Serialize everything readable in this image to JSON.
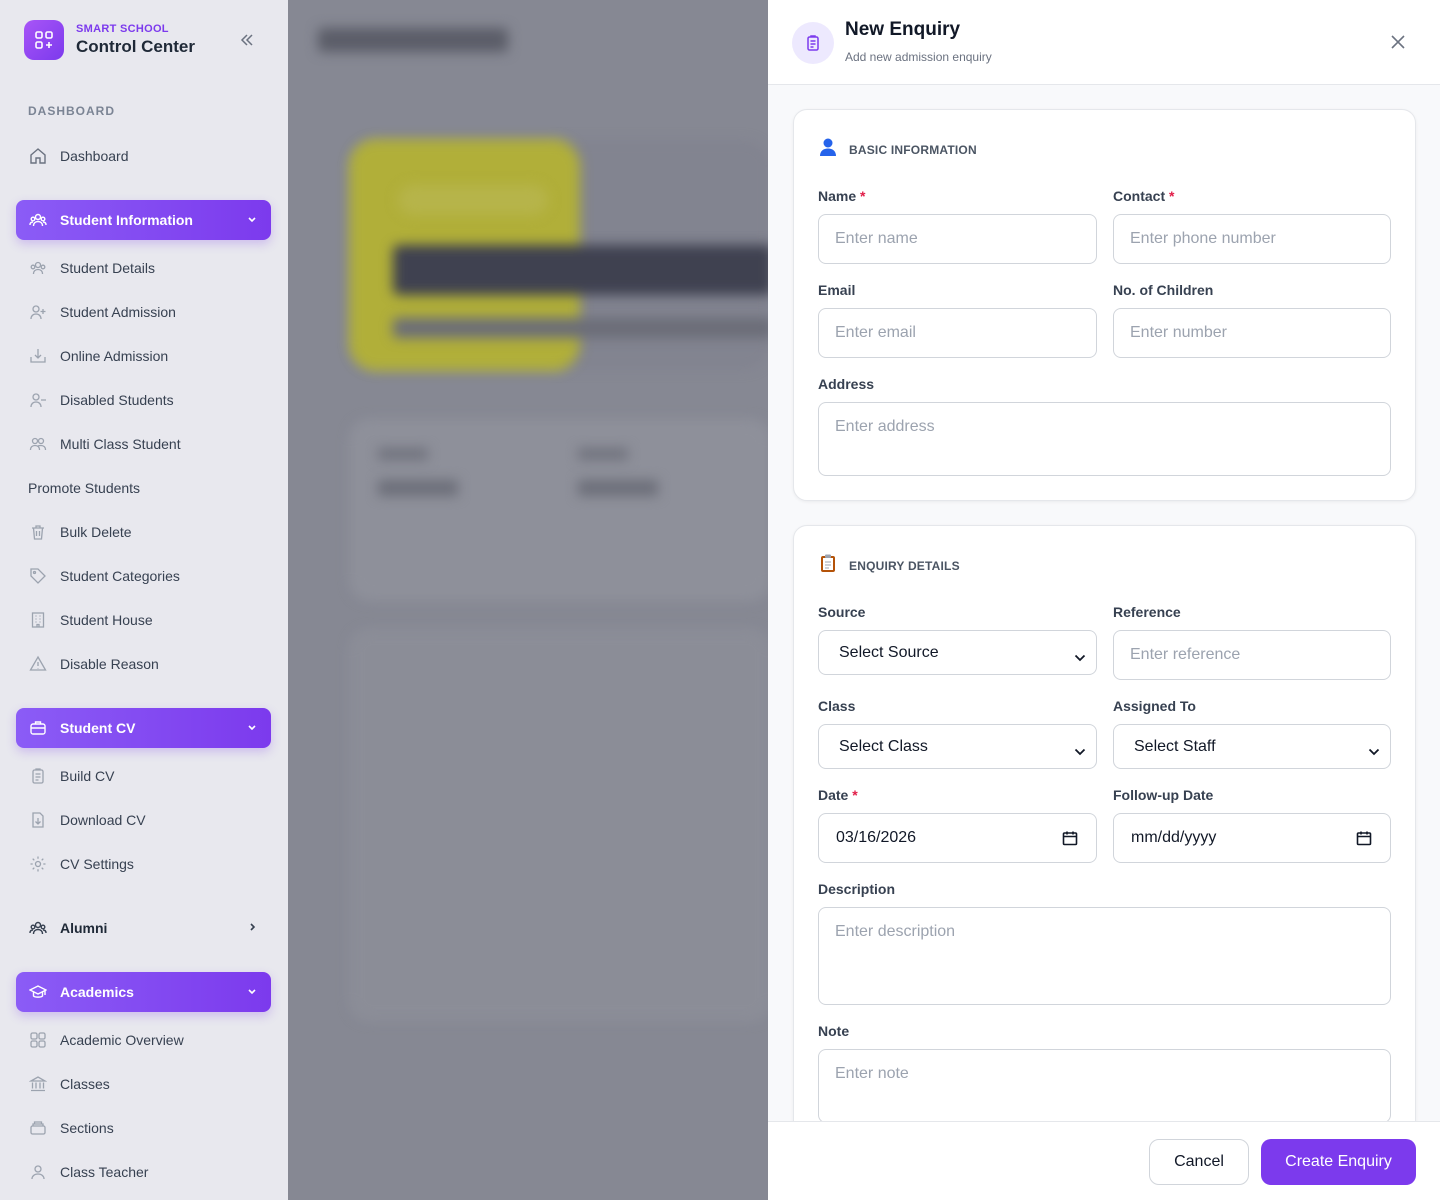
{
  "brand": {
    "subtitle": "SMART SCHOOL",
    "title": "Control Center"
  },
  "sidebar": {
    "section_label": "DASHBOARD",
    "dashboard": "Dashboard",
    "student_information": {
      "label": "Student Information",
      "items": [
        "Student Details",
        "Student Admission",
        "Online Admission",
        "Disabled Students",
        "Multi Class Student",
        "Promote Students",
        "Bulk Delete",
        "Student Categories",
        "Student House",
        "Disable Reason"
      ]
    },
    "student_cv": {
      "label": "Student CV",
      "items": [
        "Build CV",
        "Download CV",
        "CV Settings"
      ]
    },
    "alumni": {
      "label": "Alumni"
    },
    "academics": {
      "label": "Academics",
      "items": [
        "Academic Overview",
        "Classes",
        "Sections",
        "Class Teacher"
      ]
    }
  },
  "drawer": {
    "title": "New Enquiry",
    "subtitle": "Add new admission enquiry",
    "basic": {
      "heading": "BASIC INFORMATION",
      "name_label": "Name",
      "name_placeholder": "Enter name",
      "contact_label": "Contact",
      "contact_placeholder": "Enter phone number",
      "email_label": "Email",
      "email_placeholder": "Enter email",
      "children_label": "No. of Children",
      "children_placeholder": "Enter number",
      "address_label": "Address",
      "address_placeholder": "Enter address"
    },
    "enquiry": {
      "heading": "ENQUIRY DETAILS",
      "source_label": "Source",
      "source_value": "Select Source",
      "reference_label": "Reference",
      "reference_placeholder": "Enter reference",
      "class_label": "Class",
      "class_value": "Select Class",
      "assigned_label": "Assigned To",
      "assigned_value": "Select Staff",
      "date_label": "Date",
      "date_value": "03/16/2026",
      "followup_label": "Follow-up Date",
      "followup_value": "mm/dd/yyyy",
      "description_label": "Description",
      "description_placeholder": "Enter description",
      "note_label": "Note",
      "note_placeholder": "Enter note"
    },
    "required_mark": "*",
    "cancel": "Cancel",
    "create": "Create Enquiry"
  },
  "colors": {
    "accent": "#7c3aed",
    "required": "#e11d48",
    "backdrop": "#868893"
  }
}
